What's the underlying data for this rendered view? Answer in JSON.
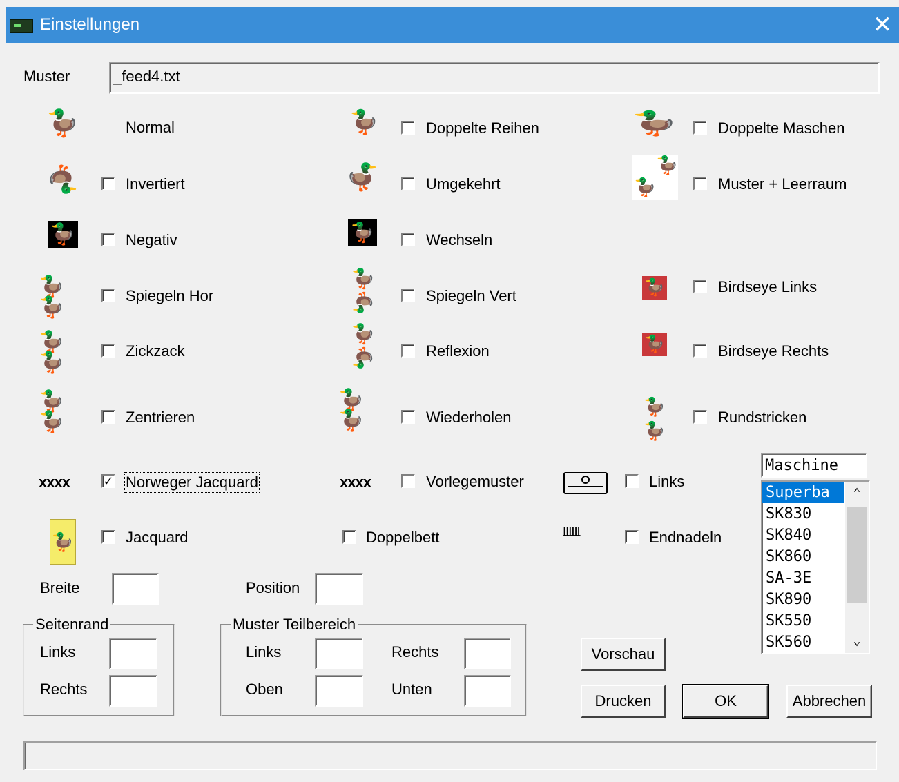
{
  "window": {
    "title": "Einstellungen",
    "close_glyph": "✕",
    "icon": "app-window-icon"
  },
  "muster": {
    "label": "Muster",
    "value": "_feed4.txt"
  },
  "options": {
    "normal": "Normal",
    "doppelte_reihen": "Doppelte Reihen",
    "doppelte_maschen": "Doppelte Maschen",
    "invertiert": "Invertiert",
    "umgekehrt": "Umgekehrt",
    "muster_leerraum": "Muster + Leerraum",
    "negativ": "Negativ",
    "wechseln": "Wechseln",
    "spiegeln_hor": "Spiegeln Hor",
    "spiegeln_vert": "Spiegeln Vert",
    "birdseye_links": "Birdseye Links",
    "zickzack": "Zickzack",
    "reflexion": "Reflexion",
    "birdseye_rechts": "Birdseye Rechts",
    "zentrieren": "Zentrieren",
    "wiederholen": "Wiederholen",
    "rundstricken": "Rundstricken",
    "norweger_jacquard": "Norweger Jacquard",
    "vorlegemuster": "Vorlegemuster",
    "links": "Links",
    "jacquard": "Jacquard",
    "doppelbett": "Doppelbett",
    "endnadeln": "Endnadeln"
  },
  "checked": {
    "norweger_jacquard": "✓"
  },
  "icons": {
    "xxxx": "xxxx",
    "needles": "ⅠⅠⅠⅠⅠⅠ"
  },
  "breite": {
    "label": "Breite",
    "value": ""
  },
  "position": {
    "label": "Position",
    "value": ""
  },
  "seitenrand": {
    "title": "Seitenrand",
    "links": "Links",
    "rechts": "Rechts"
  },
  "teilbereich": {
    "title": "Muster Teilbereich",
    "links": "Links",
    "rechts": "Rechts",
    "oben": "Oben",
    "unten": "Unten"
  },
  "maschine": {
    "label": "Maschine",
    "items": [
      "Superba",
      "SK830",
      "SK840",
      "SK860",
      "SA-3E",
      "SK890",
      "SK550",
      "SK560"
    ],
    "selected": "Superba"
  },
  "buttons": {
    "vorschau": "Vorschau",
    "drucken": "Drucken",
    "ok": "OK",
    "abbrechen": "Abbrechen"
  },
  "statusbar": {
    "text": ""
  }
}
